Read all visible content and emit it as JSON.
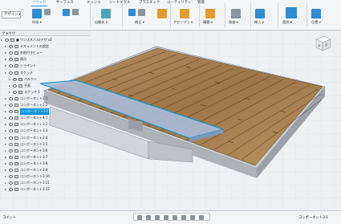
{
  "toolbar": {
    "design_label": "デザイン ▸",
    "tabs": [
      "ソリッド",
      "サーフェス",
      "メッシュ",
      "シートメタル",
      "プラスチック",
      "ユーティリティ",
      "管理"
    ],
    "groups": [
      "作成 ▾",
      "自動化 ▾",
      "修正 ▾",
      "アセンブリ ▾",
      "構築 ▾",
      "検査 ▾",
      "挿入 ▾",
      "選択 ▾",
      "位置 ▾"
    ]
  },
  "browser": {
    "header": "ブラウザ",
    "items": [
      {
        "label": "■ ワンズネバル(デザ v2",
        "indent": 1,
        "kind": "root"
      },
      {
        "label": "ドキュメントの設定",
        "indent": 2,
        "kind": "folder"
      },
      {
        "label": "名前付きビュー",
        "indent": 2,
        "kind": "folder"
      },
      {
        "label": "原点",
        "indent": 2,
        "kind": "folder"
      },
      {
        "label": "ジョイント",
        "indent": 2,
        "kind": "folder"
      },
      {
        "label": "スケッチ",
        "indent": 2,
        "kind": "folder"
      },
      {
        "label": "バルクハ",
        "indent": 3,
        "kind": "sketch"
      },
      {
        "label": "平面",
        "indent": 3,
        "kind": "sketch"
      },
      {
        "label": "スケッチ 1",
        "indent": 3,
        "kind": "sketch"
      },
      {
        "label": "コンポーネント2:1",
        "indent": 2,
        "kind": "comp"
      },
      {
        "label": "コンポーネント2:2",
        "indent": 2,
        "kind": "comp"
      },
      {
        "label": "コンポーネント3:1",
        "indent": 2,
        "kind": "comp",
        "selected": true
      },
      {
        "label": "コンポーネント4:1",
        "indent": 2,
        "kind": "comp"
      },
      {
        "label": "コンポーネント3:2",
        "indent": 2,
        "kind": "comp"
      },
      {
        "label": "コンポーネント3:3",
        "indent": 2,
        "kind": "comp"
      },
      {
        "label": "コンポーネント3:4",
        "indent": 2,
        "kind": "comp"
      },
      {
        "label": "コンポーネント3:5",
        "indent": 2,
        "kind": "comp"
      },
      {
        "label": "コンポーネント3:6",
        "indent": 2,
        "kind": "comp"
      },
      {
        "label": "コンポーネント3:7",
        "indent": 2,
        "kind": "comp"
      },
      {
        "label": "コンポーネント3:8",
        "indent": 2,
        "kind": "comp"
      },
      {
        "label": "コンポーネント3:9",
        "indent": 2,
        "kind": "comp"
      },
      {
        "label": "コンポーネント3:10",
        "indent": 2,
        "kind": "comp"
      },
      {
        "label": "コンポーネント3:11",
        "indent": 2,
        "kind": "comp"
      },
      {
        "label": "コンポーネント3:12",
        "indent": 2,
        "kind": "comp"
      }
    ]
  },
  "viewcube": {
    "front_label": "前",
    "right_label": "右"
  },
  "bottombar": {
    "left_label": "コメント",
    "status_text": "コンポーネント3:1"
  },
  "colors": {
    "accent": "#0696d7",
    "wood": "#a9845a",
    "base": "#c4c8cc"
  }
}
